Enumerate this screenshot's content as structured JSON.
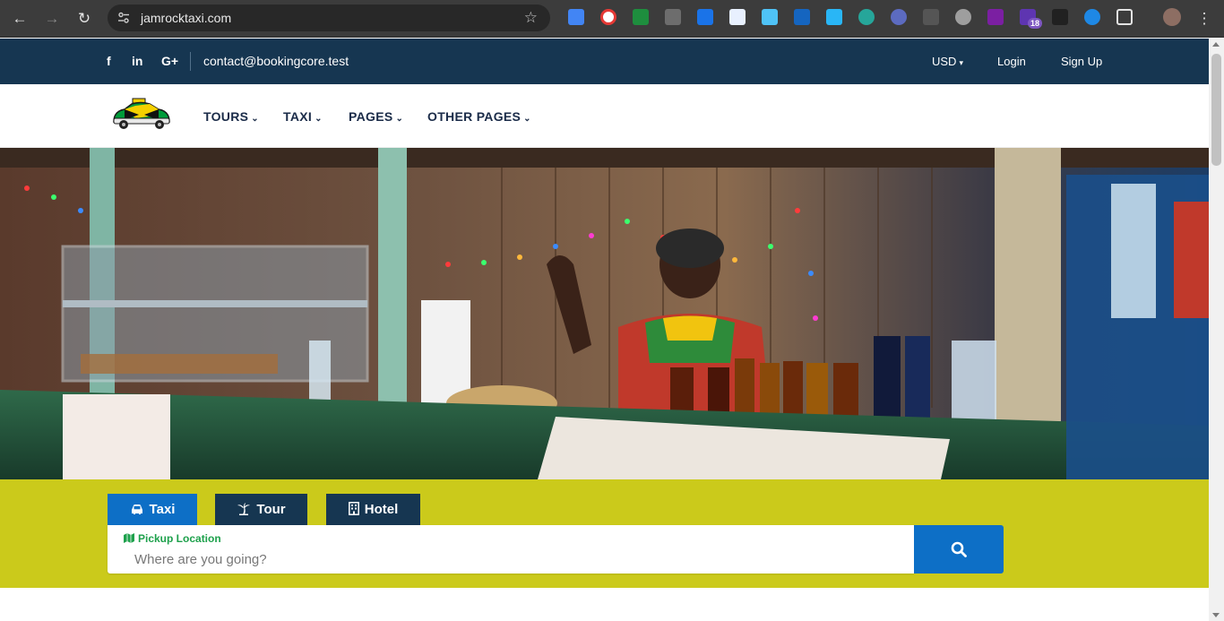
{
  "browser": {
    "url": "jamrocktaxi.com",
    "extension_badge": "18"
  },
  "topbar": {
    "social": {
      "facebook": "f",
      "linkedin": "in",
      "google_plus": "G+"
    },
    "email": "contact@bookingcore.test",
    "currency": "USD",
    "login": "Login",
    "signup": "Sign Up"
  },
  "nav": {
    "items": [
      {
        "label": "TOURS"
      },
      {
        "label": "TAXI"
      },
      {
        "label": "PAGES"
      },
      {
        "label": "OTHER PAGES"
      }
    ]
  },
  "search": {
    "tabs": [
      {
        "label": "Taxi",
        "active": true
      },
      {
        "label": "Tour",
        "active": false
      },
      {
        "label": "Hotel",
        "active": false
      }
    ],
    "field_label": "Pickup Location",
    "placeholder": "Where are you going?"
  },
  "colors": {
    "topbar": "#163651",
    "accent_blue": "#0d6fc6",
    "band_yellow": "#cbca1b",
    "label_green": "#1ea14c",
    "tab_dark": "#163651"
  }
}
